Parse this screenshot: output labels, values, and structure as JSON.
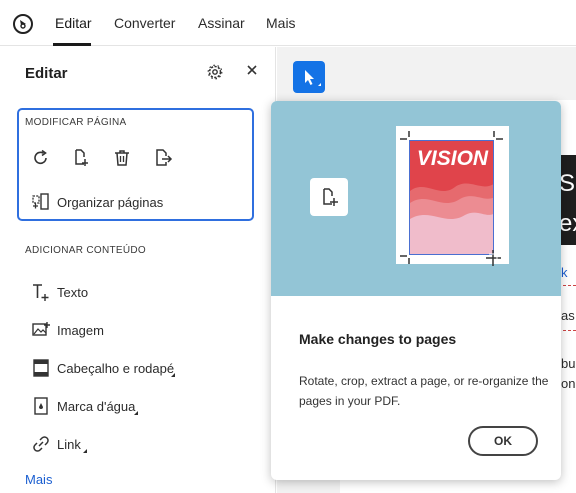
{
  "topbar": {
    "tabs": [
      {
        "label": "Editar",
        "active": true
      },
      {
        "label": "Converter",
        "active": false
      },
      {
        "label": "Assinar",
        "active": false
      },
      {
        "label": "Mais",
        "active": false
      }
    ]
  },
  "panel": {
    "title": "Editar",
    "modify_section": {
      "label": "MODIFICAR PÁGINA",
      "icons": [
        "rotate-icon",
        "crop-page-icon",
        "delete-page-icon",
        "extract-page-icon"
      ],
      "organize_label": "Organizar páginas"
    },
    "add_section": {
      "label": "ADICIONAR CONTEÚDO",
      "items": [
        {
          "label": "Texto",
          "icon": "add-text-icon"
        },
        {
          "label": "Imagem",
          "icon": "add-image-icon"
        },
        {
          "label": "Cabeçalho e rodapé",
          "icon": "header-footer-icon"
        },
        {
          "label": "Marca d'água",
          "icon": "watermark-icon"
        },
        {
          "label": "Link",
          "icon": "link-icon"
        }
      ]
    },
    "more_label": "Mais"
  },
  "document": {
    "fragments": [
      "S",
      "ex",
      "k",
      "as",
      "bu",
      "on"
    ]
  },
  "popover": {
    "poster_title": "VISION",
    "heading": "Make changes to pages",
    "body": "Rotate, crop, extract a page, or re-organize the pages in your PDF.",
    "ok_label": "OK"
  },
  "colors": {
    "accent": "#1473e6",
    "focus_border": "#2f6fdf",
    "link": "#1b5fd1",
    "hero_bg": "#93c5d6",
    "poster_red": "#e0444b",
    "poster_pink": "#e8a9b8"
  }
}
